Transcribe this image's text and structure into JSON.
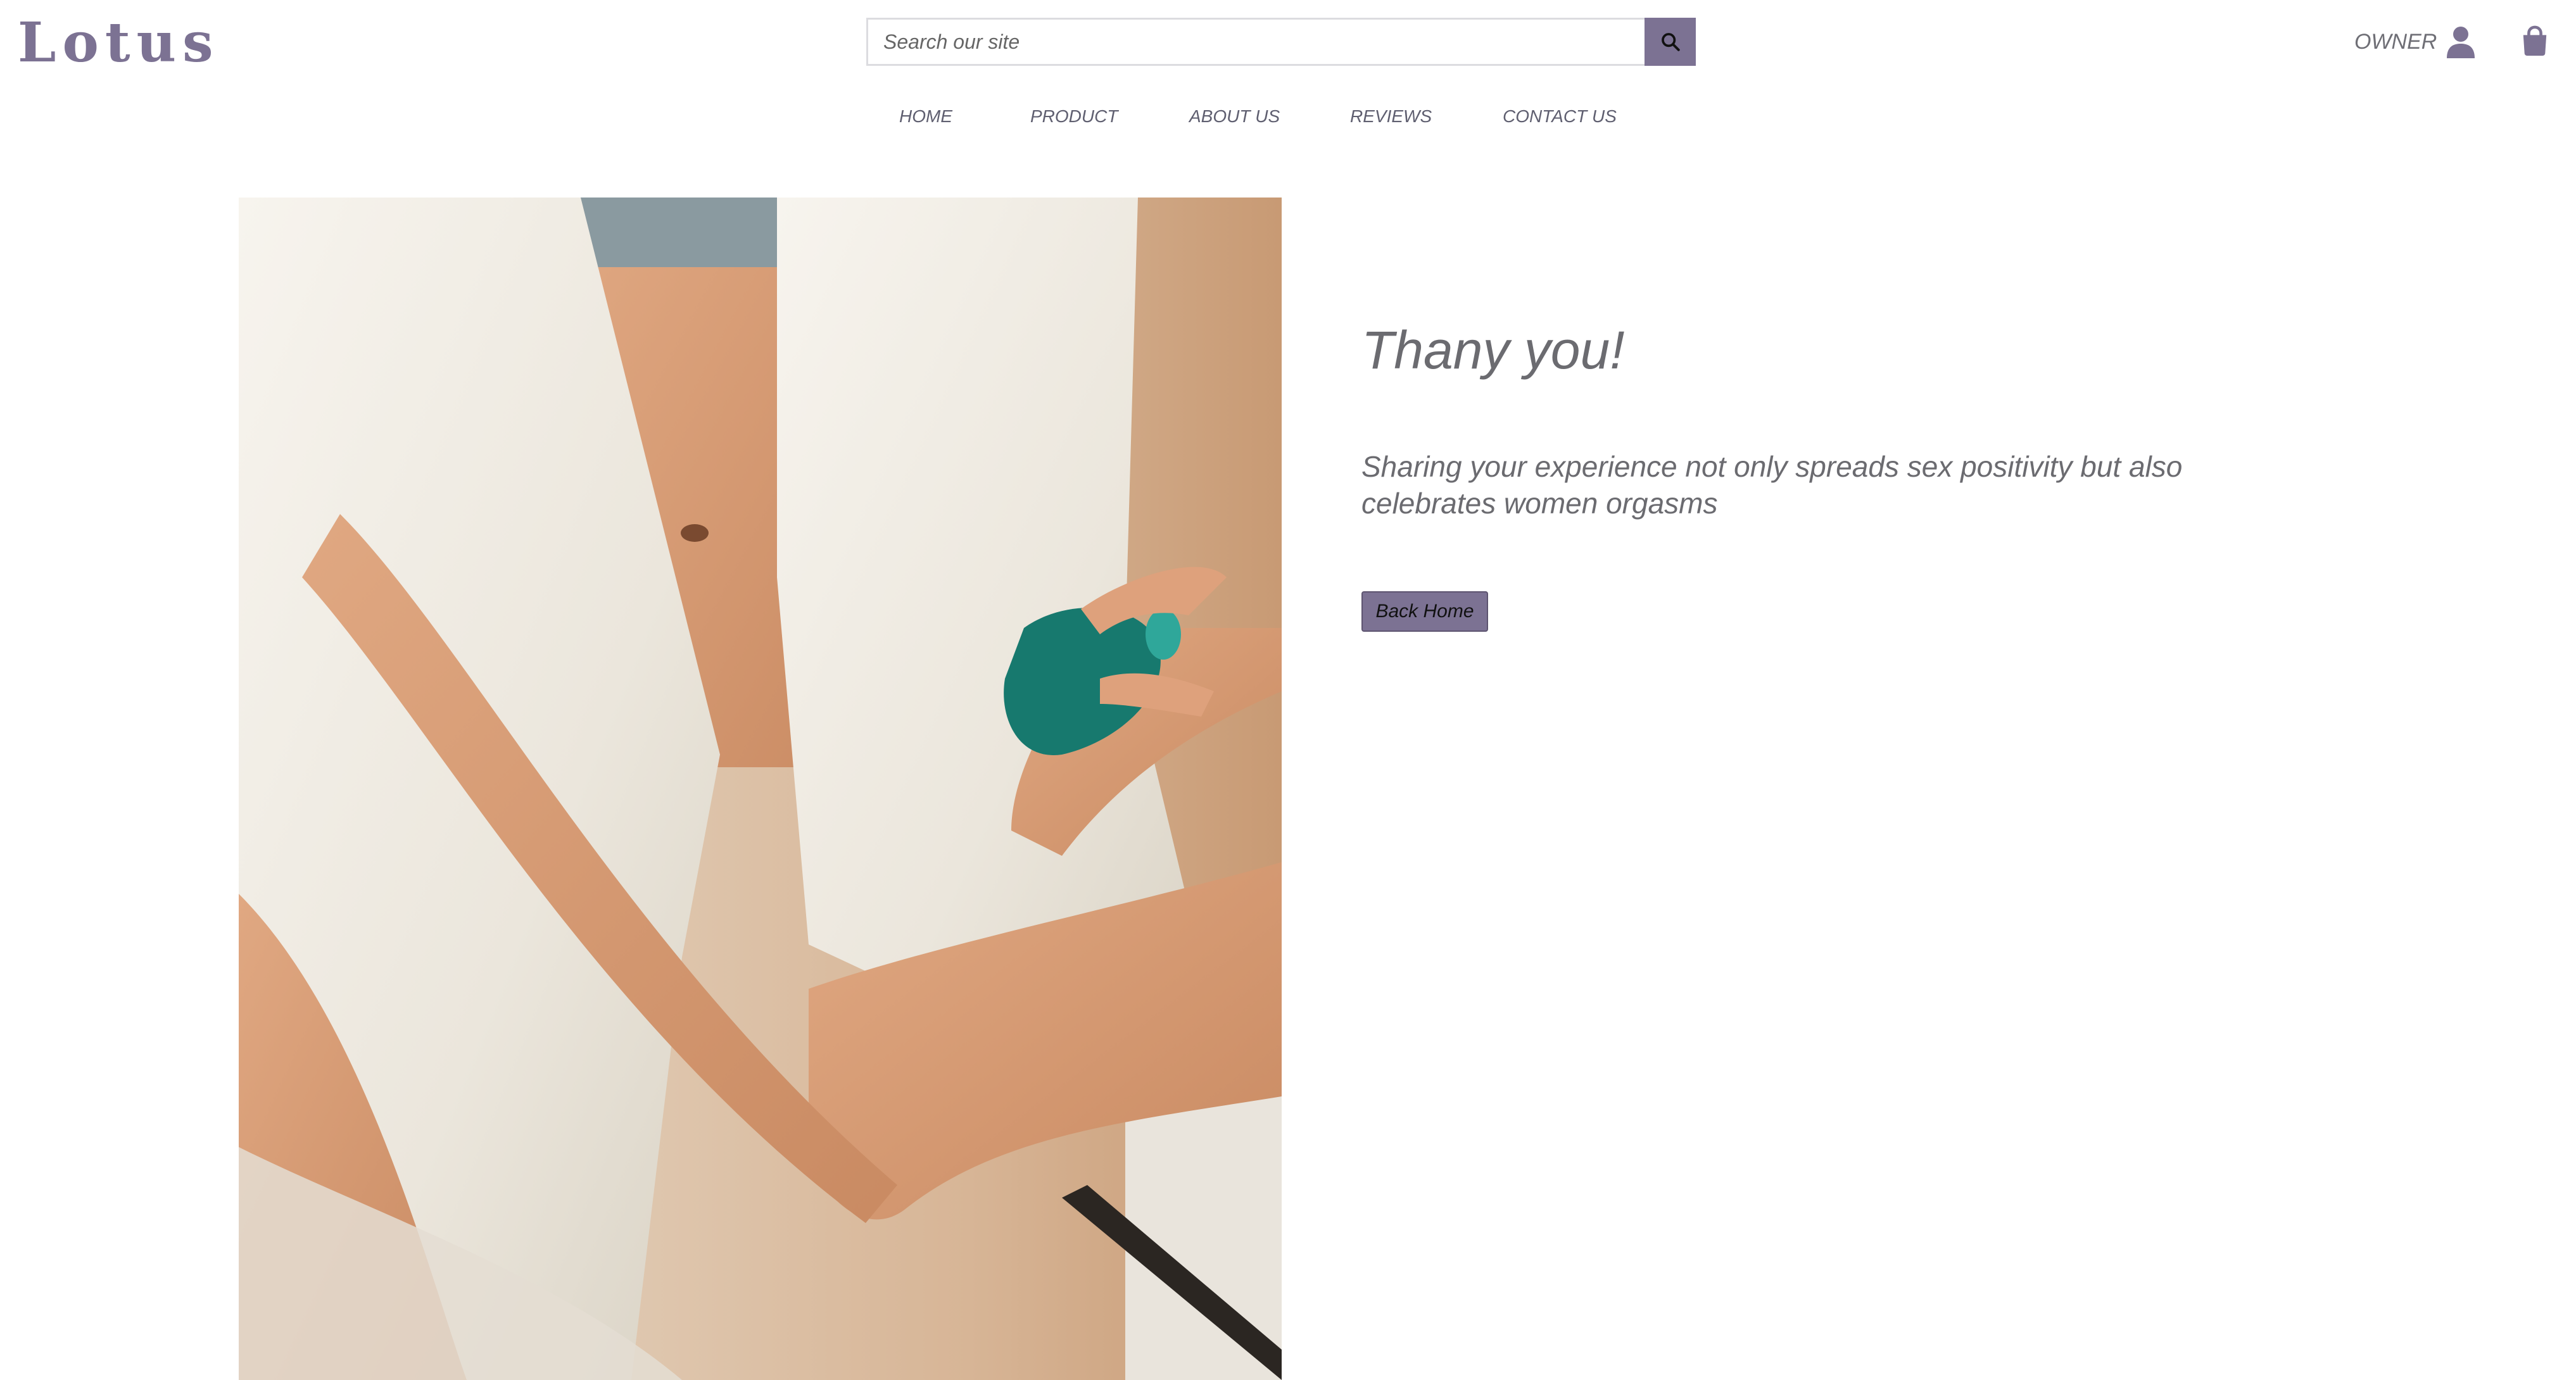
{
  "header": {
    "logo": "Lotus",
    "search": {
      "placeholder": "Search our site",
      "icon": "search-icon"
    },
    "account_label": "OWNER",
    "account_icon": "user-icon",
    "cart_icon": "shopping-bag-icon"
  },
  "nav": {
    "items": [
      {
        "label": "HOME"
      },
      {
        "label": "PRODUCT"
      },
      {
        "label": "ABOUT US"
      },
      {
        "label": "REVIEWS"
      },
      {
        "label": "CONTACT US"
      }
    ]
  },
  "main": {
    "title": "Thany you!",
    "message": "Sharing your experience not only spreads sex positivity but also celebrates women orgasms",
    "back_button": "Back Home"
  },
  "colors": {
    "brand": "#7c7293",
    "text": "#6b6b70"
  }
}
